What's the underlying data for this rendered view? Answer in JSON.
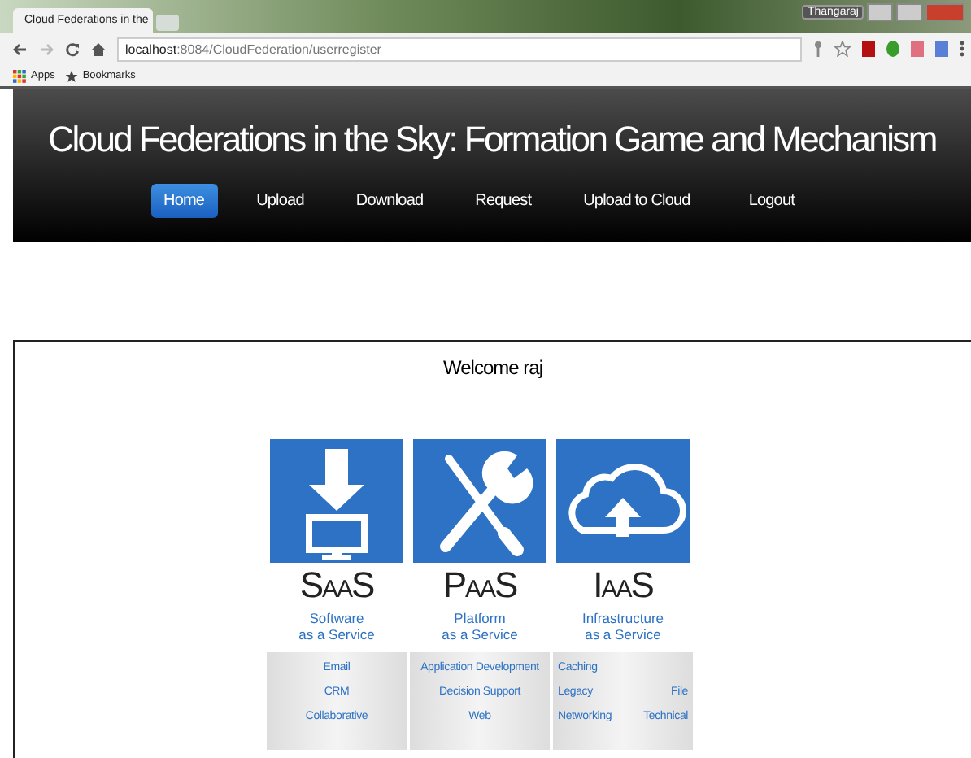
{
  "browser": {
    "tab_title": "Cloud Federations in the",
    "user": "Thangaraj",
    "url_host": "localhost",
    "url_path": ":8084/CloudFederation/userregister",
    "bookmarks": [
      "Apps",
      "Bookmarks"
    ]
  },
  "header": {
    "title": "Cloud Federations in the Sky: Formation Game and Mechanism"
  },
  "nav": [
    {
      "label": "Home",
      "selected": true
    },
    {
      "label": "Upload",
      "selected": false
    },
    {
      "label": "Download",
      "selected": false
    },
    {
      "label": "Request",
      "selected": false
    },
    {
      "label": "Upload to Cloud",
      "selected": false
    }
  ],
  "logout": "Logout",
  "welcome": "Welcome raj",
  "services": [
    {
      "kind": "download",
      "name": "SaaS",
      "subtitle": [
        "Software",
        "as a Service"
      ],
      "rows": [
        [
          "Email"
        ],
        [
          "CRM"
        ],
        [
          "Collaborative"
        ]
      ]
    },
    {
      "kind": "tools",
      "name": "PaaS",
      "subtitle": [
        "Platform",
        "as a Service"
      ],
      "rows": [
        [
          "Application Development"
        ],
        [
          "Decision Support"
        ],
        [
          "Web"
        ]
      ]
    },
    {
      "kind": "cloud",
      "name": "IaaS",
      "subtitle": [
        "Infrastructure",
        "as a Service"
      ],
      "rows": [
        [
          "Caching"
        ],
        [
          "Legacy",
          "File"
        ],
        [
          "Networking",
          "Technical"
        ]
      ]
    }
  ]
}
